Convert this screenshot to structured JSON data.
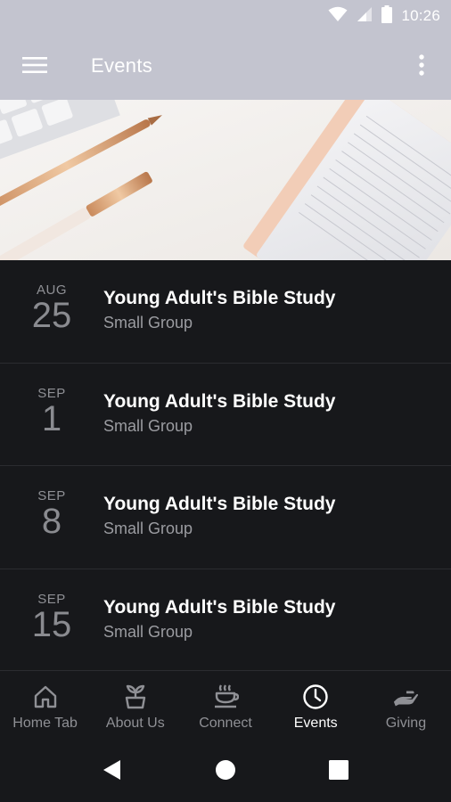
{
  "status_bar": {
    "time": "10:26",
    "icons": [
      "wifi-icon",
      "signal-icon",
      "battery-icon"
    ]
  },
  "app_bar": {
    "title": "Events",
    "menu_icon": "menu-icon",
    "overflow_icon": "more-vert-icon"
  },
  "hero": {
    "image": "desk-stationery-photo"
  },
  "events": [
    {
      "month": "AUG",
      "day": "25",
      "name": "Young Adult's Bible Study",
      "category": "Small Group"
    },
    {
      "month": "SEP",
      "day": "1",
      "name": "Young Adult's Bible Study",
      "category": "Small Group"
    },
    {
      "month": "SEP",
      "day": "8",
      "name": "Young Adult's Bible Study",
      "category": "Small Group"
    },
    {
      "month": "SEP",
      "day": "15",
      "name": "Young Adult's Bible Study",
      "category": "Small Group"
    }
  ],
  "bottom_nav": {
    "items": [
      {
        "label": "Home Tab",
        "icon": "home-icon",
        "active": false
      },
      {
        "label": "About Us",
        "icon": "plant-icon",
        "active": false
      },
      {
        "label": "Connect",
        "icon": "coffee-icon",
        "active": false
      },
      {
        "label": "Events",
        "icon": "clock-icon",
        "active": true
      },
      {
        "label": "Giving",
        "icon": "giving-hand-icon",
        "active": false
      }
    ]
  },
  "system_nav": {
    "buttons": [
      "back-icon",
      "home-circle-icon",
      "recents-icon"
    ]
  },
  "colors": {
    "app_bar": "#c3c4cf",
    "background": "#17181b",
    "active_nav": "#ffffff",
    "inactive_nav": "#8f9095"
  }
}
